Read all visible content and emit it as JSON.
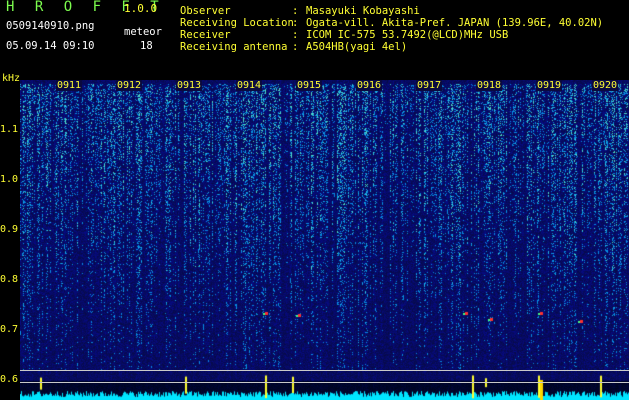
{
  "header": {
    "app_title": "H R O F F T",
    "app_version": "1.0.0",
    "file_name": "0509140910.png",
    "meteor_label": "meteor",
    "meteor_count": "18",
    "timestamp": "05.09.14 09:10"
  },
  "metadata": [
    {
      "key": "Observer",
      "value": "Masayuki Kobayashi"
    },
    {
      "key": "Receiving Location",
      "value": "Ogata-vill. Akita-Pref. JAPAN (139.96E, 40.02N)"
    },
    {
      "key": "Receiver",
      "value": "ICOM IC-575 53.7492(@LCD)MHz USB"
    },
    {
      "key": "Receiving antenna",
      "value": "A504HB(yagi 4el)"
    }
  ],
  "meta_separator": ":",
  "axis": {
    "unit": "kHz",
    "y_ticks": [
      "1.1",
      "1.0",
      "0.9",
      "0.8",
      "0.7",
      "0.6"
    ],
    "x_ticks": [
      "0911",
      "0912",
      "0913",
      "0914",
      "0915",
      "0916",
      "0917",
      "0918",
      "0919",
      "0920"
    ]
  },
  "colors": {
    "text_green": "#7cfc4e",
    "text_yellow": "#ffff33",
    "background": "#000000",
    "noise_floor": "#12186e",
    "signal_trace": "#00ffff"
  }
}
